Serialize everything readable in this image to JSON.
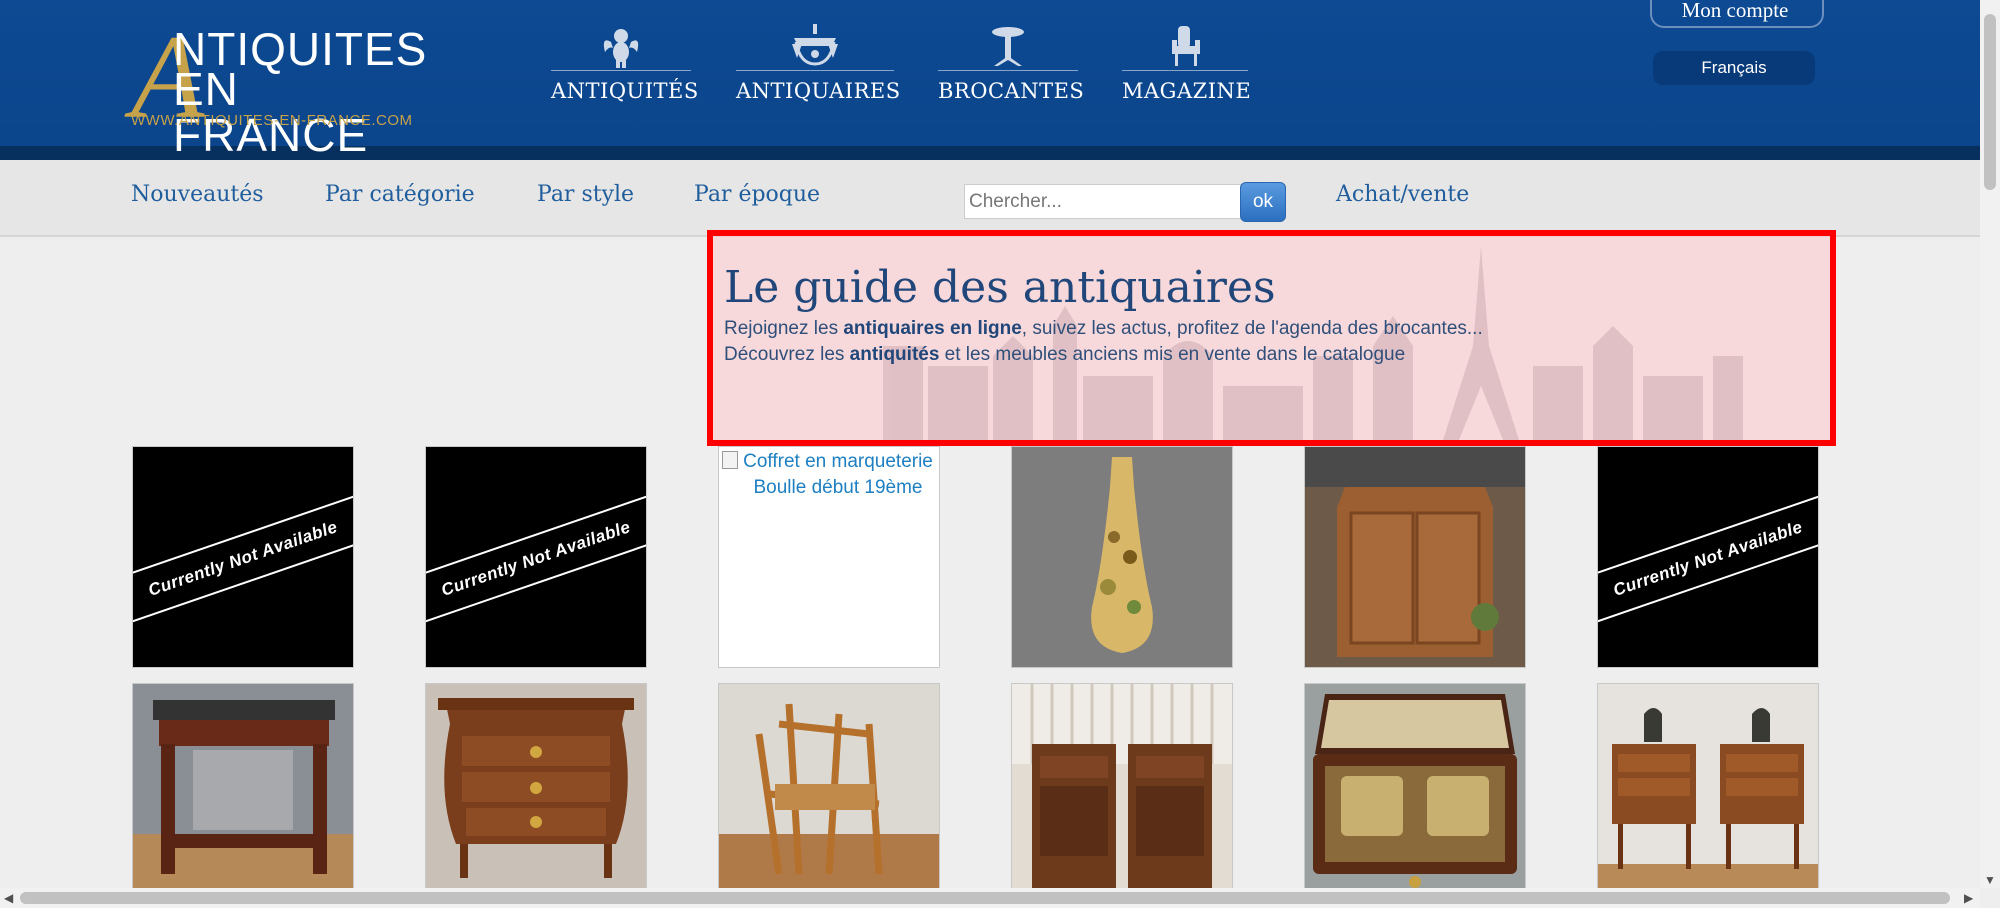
{
  "header": {
    "logo": {
      "line1": "NTIQUITES",
      "initial": "A",
      "line2": "EN FRANCE",
      "url": "WWW.ANTIQUITES-EN-FRANCE.COM"
    },
    "nav": [
      {
        "label": "ANTIQUITÉS",
        "icon": "cherub-icon"
      },
      {
        "label": "ANTIQUAIRES",
        "icon": "chandelier-icon"
      },
      {
        "label": "BROCANTES",
        "icon": "gueridon-table-icon"
      },
      {
        "label": "MAGAZINE",
        "icon": "armchair-icon"
      }
    ],
    "account_label": "Mon compte",
    "language": "Français"
  },
  "subnav": {
    "links": [
      "Nouveautés",
      "Par catégorie",
      "Par style",
      "Par époque"
    ],
    "search_placeholder": "Chercher...",
    "search_button": "ok",
    "buy_sell": "Achat/vente"
  },
  "hero": {
    "title": "Le guide des antiquaires",
    "line1_pre": "Rejoignez les ",
    "line1_bold": "antiquaires en ligne",
    "line1_post": ", suivez les actus, profitez de l'agenda des brocantes...",
    "line2_pre": "Découvrez les ",
    "line2_bold": "antiquités",
    "line2_post": " et les meubles anciens mis en vente dans le catalogue"
  },
  "grid": {
    "row1": [
      {
        "kind": "unavailable",
        "text": "Currently Not Available"
      },
      {
        "kind": "unavailable",
        "text": "Currently Not Available"
      },
      {
        "kind": "broken",
        "alt": "Coffret en marqueterie Boulle début 19ème"
      },
      {
        "kind": "photo",
        "subject": "vase"
      },
      {
        "kind": "photo",
        "subject": "armoire"
      },
      {
        "kind": "unavailable",
        "text": "Currently Not Available"
      }
    ],
    "row2": [
      {
        "kind": "photo",
        "subject": "console"
      },
      {
        "kind": "photo",
        "subject": "commode"
      },
      {
        "kind": "photo",
        "subject": "bamboo-chair"
      },
      {
        "kind": "photo",
        "subject": "bedside-tables"
      },
      {
        "kind": "photo",
        "subject": "inkwell-box"
      },
      {
        "kind": "photo",
        "subject": "side-tables-with-bronzes"
      }
    ]
  },
  "colors": {
    "header_blue": "#0d4a93",
    "gold": "#c6a24a",
    "link_blue": "#1f5d9c",
    "highlight_red": "#ff0000"
  }
}
